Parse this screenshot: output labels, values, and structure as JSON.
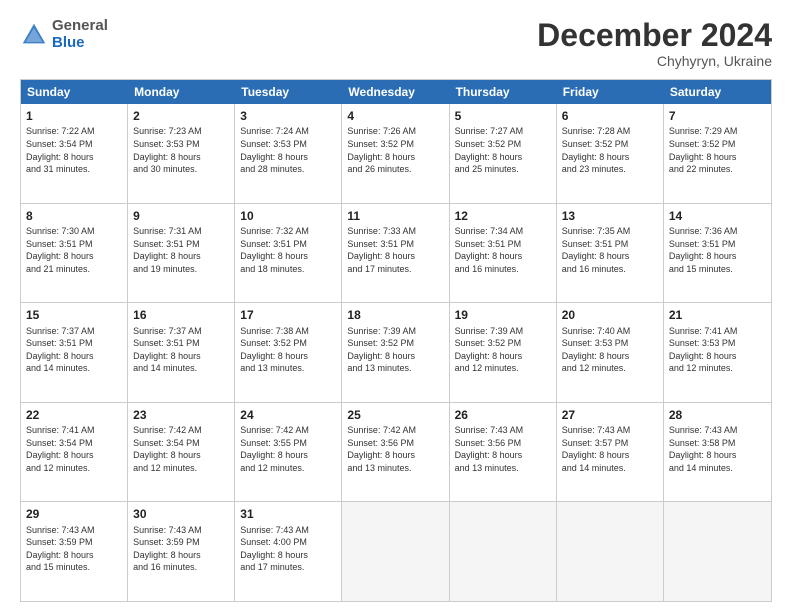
{
  "logo": {
    "general": "General",
    "blue": "Blue"
  },
  "header": {
    "month": "December 2024",
    "location": "Chyhyryn, Ukraine"
  },
  "weekdays": [
    "Sunday",
    "Monday",
    "Tuesday",
    "Wednesday",
    "Thursday",
    "Friday",
    "Saturday"
  ],
  "rows": [
    [
      {
        "day": "1",
        "sunrise": "7:22 AM",
        "sunset": "3:54 PM",
        "daylight": "8 hours and 31 minutes."
      },
      {
        "day": "2",
        "sunrise": "7:23 AM",
        "sunset": "3:53 PM",
        "daylight": "8 hours and 30 minutes."
      },
      {
        "day": "3",
        "sunrise": "7:24 AM",
        "sunset": "3:53 PM",
        "daylight": "8 hours and 28 minutes."
      },
      {
        "day": "4",
        "sunrise": "7:26 AM",
        "sunset": "3:52 PM",
        "daylight": "8 hours and 26 minutes."
      },
      {
        "day": "5",
        "sunrise": "7:27 AM",
        "sunset": "3:52 PM",
        "daylight": "8 hours and 25 minutes."
      },
      {
        "day": "6",
        "sunrise": "7:28 AM",
        "sunset": "3:52 PM",
        "daylight": "8 hours and 23 minutes."
      },
      {
        "day": "7",
        "sunrise": "7:29 AM",
        "sunset": "3:52 PM",
        "daylight": "8 hours and 22 minutes."
      }
    ],
    [
      {
        "day": "8",
        "sunrise": "7:30 AM",
        "sunset": "3:51 PM",
        "daylight": "8 hours and 21 minutes."
      },
      {
        "day": "9",
        "sunrise": "7:31 AM",
        "sunset": "3:51 PM",
        "daylight": "8 hours and 19 minutes."
      },
      {
        "day": "10",
        "sunrise": "7:32 AM",
        "sunset": "3:51 PM",
        "daylight": "8 hours and 18 minutes."
      },
      {
        "day": "11",
        "sunrise": "7:33 AM",
        "sunset": "3:51 PM",
        "daylight": "8 hours and 17 minutes."
      },
      {
        "day": "12",
        "sunrise": "7:34 AM",
        "sunset": "3:51 PM",
        "daylight": "8 hours and 16 minutes."
      },
      {
        "day": "13",
        "sunrise": "7:35 AM",
        "sunset": "3:51 PM",
        "daylight": "8 hours and 16 minutes."
      },
      {
        "day": "14",
        "sunrise": "7:36 AM",
        "sunset": "3:51 PM",
        "daylight": "8 hours and 15 minutes."
      }
    ],
    [
      {
        "day": "15",
        "sunrise": "7:37 AM",
        "sunset": "3:51 PM",
        "daylight": "8 hours and 14 minutes."
      },
      {
        "day": "16",
        "sunrise": "7:37 AM",
        "sunset": "3:51 PM",
        "daylight": "8 hours and 14 minutes."
      },
      {
        "day": "17",
        "sunrise": "7:38 AM",
        "sunset": "3:52 PM",
        "daylight": "8 hours and 13 minutes."
      },
      {
        "day": "18",
        "sunrise": "7:39 AM",
        "sunset": "3:52 PM",
        "daylight": "8 hours and 13 minutes."
      },
      {
        "day": "19",
        "sunrise": "7:39 AM",
        "sunset": "3:52 PM",
        "daylight": "8 hours and 12 minutes."
      },
      {
        "day": "20",
        "sunrise": "7:40 AM",
        "sunset": "3:53 PM",
        "daylight": "8 hours and 12 minutes."
      },
      {
        "day": "21",
        "sunrise": "7:41 AM",
        "sunset": "3:53 PM",
        "daylight": "8 hours and 12 minutes."
      }
    ],
    [
      {
        "day": "22",
        "sunrise": "7:41 AM",
        "sunset": "3:54 PM",
        "daylight": "8 hours and 12 minutes."
      },
      {
        "day": "23",
        "sunrise": "7:42 AM",
        "sunset": "3:54 PM",
        "daylight": "8 hours and 12 minutes."
      },
      {
        "day": "24",
        "sunrise": "7:42 AM",
        "sunset": "3:55 PM",
        "daylight": "8 hours and 12 minutes."
      },
      {
        "day": "25",
        "sunrise": "7:42 AM",
        "sunset": "3:56 PM",
        "daylight": "8 hours and 13 minutes."
      },
      {
        "day": "26",
        "sunrise": "7:43 AM",
        "sunset": "3:56 PM",
        "daylight": "8 hours and 13 minutes."
      },
      {
        "day": "27",
        "sunrise": "7:43 AM",
        "sunset": "3:57 PM",
        "daylight": "8 hours and 14 minutes."
      },
      {
        "day": "28",
        "sunrise": "7:43 AM",
        "sunset": "3:58 PM",
        "daylight": "8 hours and 14 minutes."
      }
    ],
    [
      {
        "day": "29",
        "sunrise": "7:43 AM",
        "sunset": "3:59 PM",
        "daylight": "8 hours and 15 minutes."
      },
      {
        "day": "30",
        "sunrise": "7:43 AM",
        "sunset": "3:59 PM",
        "daylight": "8 hours and 16 minutes."
      },
      {
        "day": "31",
        "sunrise": "7:43 AM",
        "sunset": "4:00 PM",
        "daylight": "8 hours and 17 minutes."
      },
      null,
      null,
      null,
      null
    ]
  ],
  "labels": {
    "sunrise": "Sunrise: ",
    "sunset": "Sunset: ",
    "daylight": "Daylight hours"
  }
}
